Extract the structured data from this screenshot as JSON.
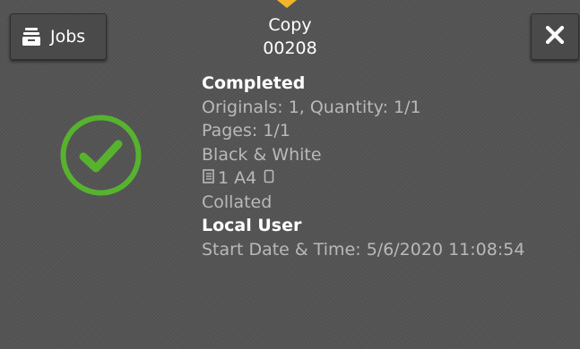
{
  "header": {
    "jobs_label": "Jobs",
    "title": "Copy",
    "job_number": "00208"
  },
  "icons": {
    "jobs": "jobs-tray-icon",
    "close": "close-icon",
    "status": "checkmark-circle-icon",
    "originals": "document-stack-icon",
    "orientation": "portrait-page-icon"
  },
  "details": {
    "status": "Completed",
    "originals_quantity": "Originals: 1, Quantity: 1/1",
    "pages": "Pages: 1/1",
    "color_mode": "Black & White",
    "paper": "1 A4",
    "finishing": "Collated",
    "owner": "Local User",
    "start_datetime": "Start Date & Time: 5/6/2020 11:08:54"
  },
  "colors": {
    "success_ring": "#57b32e",
    "accent_notch": "#f0b52a"
  }
}
